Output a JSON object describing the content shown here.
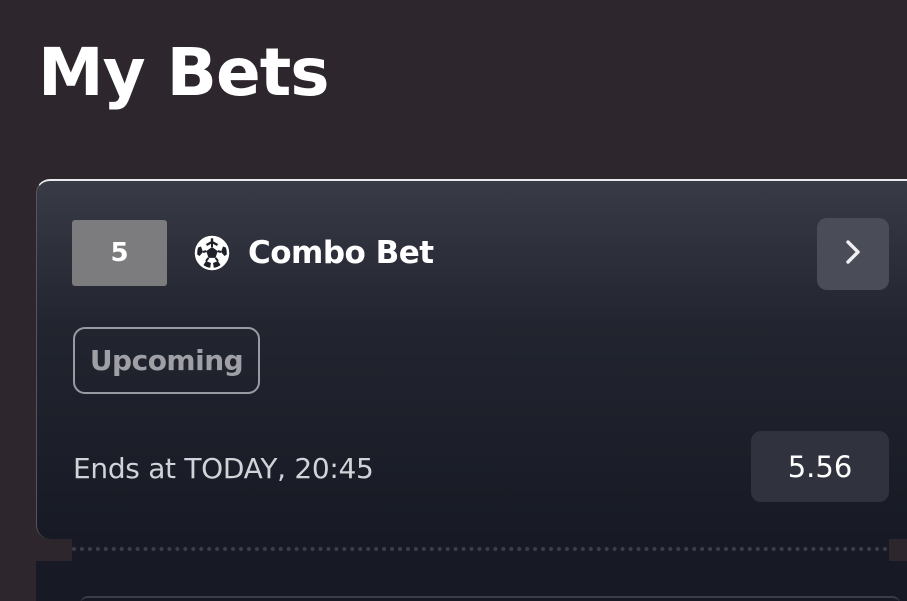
{
  "page": {
    "title": "My Bets"
  },
  "bet": {
    "leg_count": "5",
    "sport_icon": "soccer-ball-icon",
    "type_label": "Combo Bet",
    "details_icon": "chevron-right-icon",
    "status": "Upcoming",
    "ends_at": "Ends at TODAY, 20:45",
    "odds": "5.56"
  },
  "colors": {
    "background": "#2d272d",
    "card_top": "#383b45",
    "card_bottom": "#171a24",
    "leg_count_bg": "#7c7c7e",
    "details_button_bg": "#4a4d57",
    "odds_bg": "#30333d",
    "status_text": "#9fa0a6"
  }
}
